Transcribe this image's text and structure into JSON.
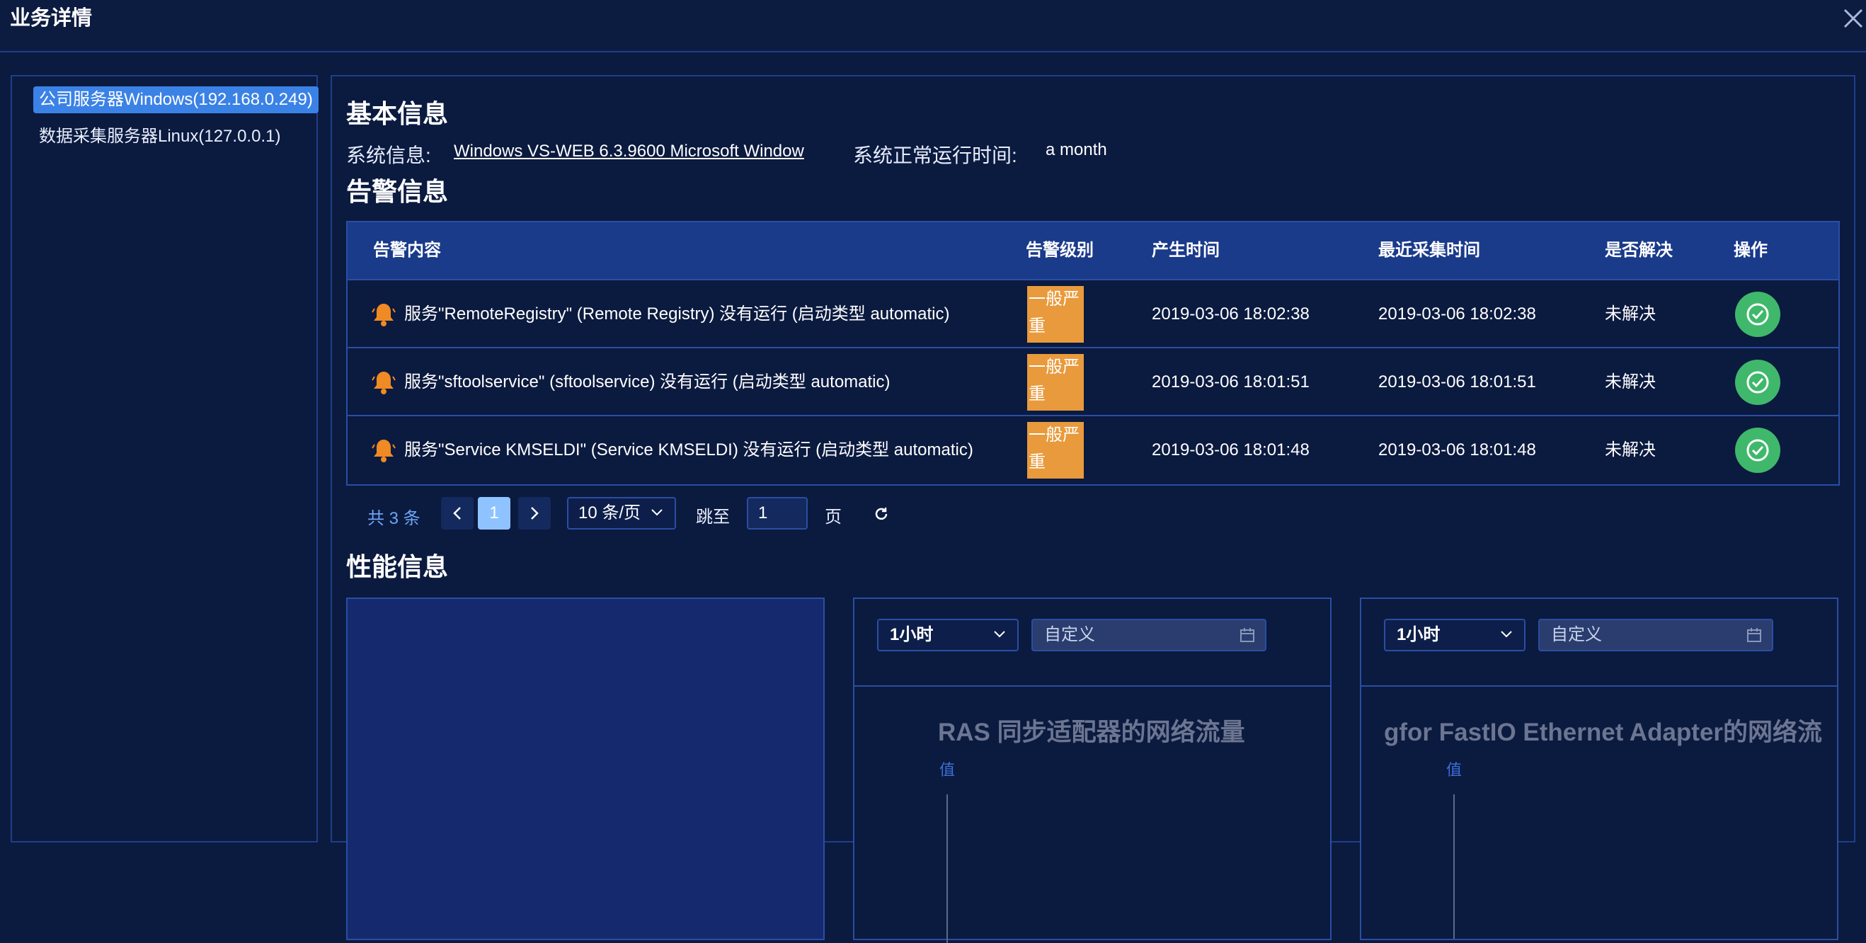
{
  "dialog": {
    "title": "业务详情"
  },
  "sidebar": {
    "items": [
      {
        "label": "公司服务器Windows(192.168.0.249)",
        "active": true
      },
      {
        "label": "数据采集服务器Linux(127.0.0.1)",
        "active": false
      }
    ]
  },
  "basic": {
    "title": "基本信息",
    "sysinfo_label": "系统信息:",
    "sysinfo_value": "Windows VS-WEB 6.3.9600 Microsoft Window",
    "uptime_label": "系统正常运行时间:",
    "uptime_value": "a month"
  },
  "alarms": {
    "title": "告警信息",
    "columns": [
      "告警内容",
      "告警级别",
      "产生时间",
      "最近采集时间",
      "是否解决",
      "操作"
    ],
    "rows": [
      {
        "content": "服务\"RemoteRegistry\" (Remote Registry) 没有运行 (启动类型 automatic)",
        "level": "一般严重",
        "created": "2019-03-06 18:02:38",
        "collected": "2019-03-06 18:02:38",
        "resolved": "未解决"
      },
      {
        "content": "服务\"sftoolservice\" (sftoolservice) 没有运行 (启动类型 automatic)",
        "level": "一般严重",
        "created": "2019-03-06 18:01:51",
        "collected": "2019-03-06 18:01:51",
        "resolved": "未解决"
      },
      {
        "content": "服务\"Service KMSELDI\" (Service KMSELDI) 没有运行 (启动类型 automatic)",
        "level": "一般严重",
        "created": "2019-03-06 18:01:48",
        "collected": "2019-03-06 18:01:48",
        "resolved": "未解决"
      }
    ]
  },
  "pager": {
    "total": "共 3 条",
    "current_page": "1",
    "page_size": "10 条/页",
    "jump_label": "跳至",
    "jump_value": "1",
    "page_label": "页"
  },
  "perf": {
    "title": "性能信息",
    "cards": [
      {
        "range": "1小时",
        "date_placeholder": "自定义",
        "chart_title": "RAS 同步适配器的网络流量",
        "ylabel": "值"
      },
      {
        "range": "1小时",
        "date_placeholder": "自定义",
        "chart_title": "gfor FastIO Ethernet Adapter的网络流",
        "ylabel": "值"
      }
    ]
  },
  "colors": {
    "background": "#0b1a3f",
    "accent": "#3b82e6",
    "level_badge": "#e89a3c",
    "resolve_button": "#3fb86b"
  },
  "icons": [
    "close-icon",
    "bell-icon",
    "check-circle-icon",
    "chevron-left-icon",
    "chevron-right-icon",
    "chevron-down-icon",
    "refresh-icon",
    "calendar-icon"
  ]
}
